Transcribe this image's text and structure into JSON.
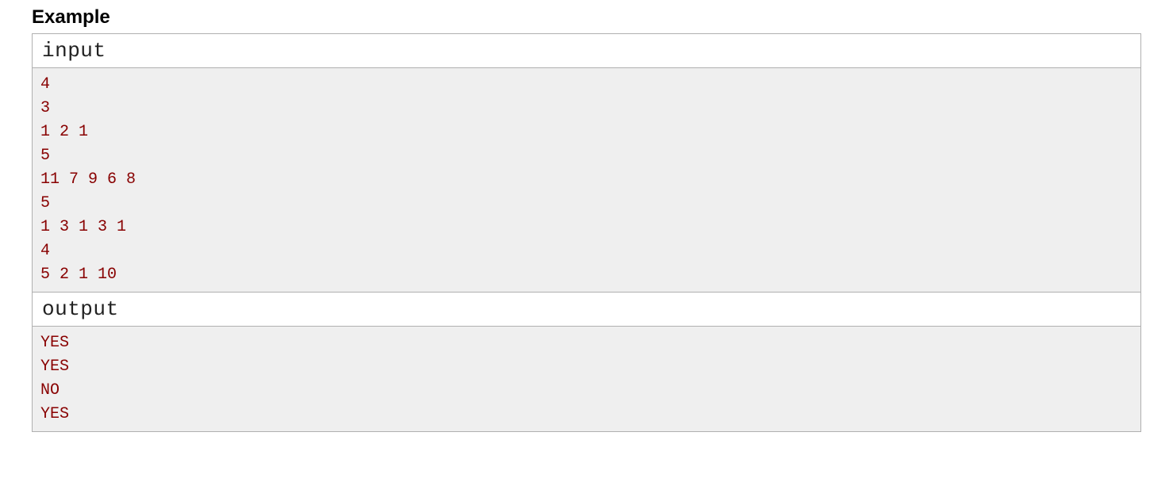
{
  "title": "Example",
  "input": {
    "label": "input",
    "content": "4\n3\n1 2 1\n5\n11 7 9 6 8\n5\n1 3 1 3 1\n4\n5 2 1 10"
  },
  "output": {
    "label": "output",
    "content": "YES\nYES\nNO\nYES"
  }
}
